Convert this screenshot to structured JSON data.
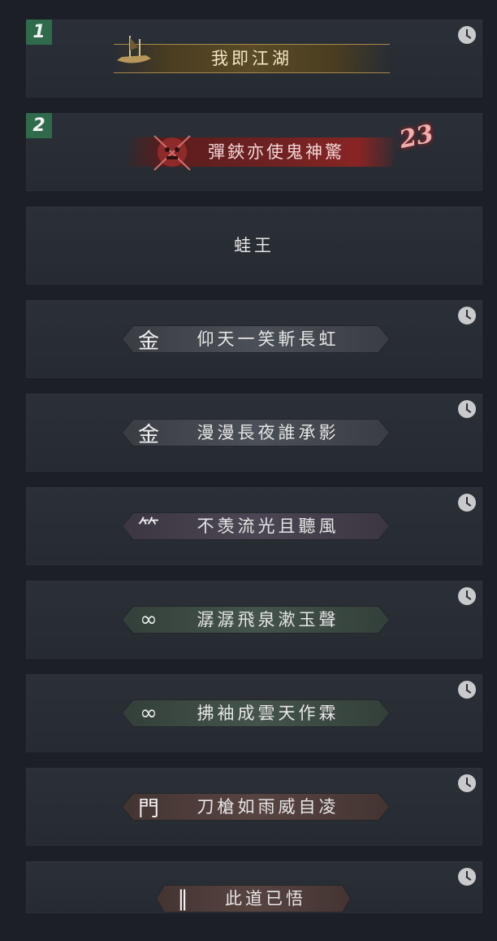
{
  "entries": [
    {
      "rank": "1",
      "title": "我即江湖"
    },
    {
      "rank": "2",
      "title": "彈鋏亦使鬼神驚",
      "count": "23"
    },
    {
      "title": "蛙王"
    },
    {
      "title": "仰天一笑斬長虹",
      "icon": "sect-emblem-icon"
    },
    {
      "title": "漫漫長夜誰承影",
      "icon": "sect-emblem-icon"
    },
    {
      "title": "不羡流光且聽風",
      "icon": "bamboo-icon"
    },
    {
      "title": "潺潺飛泉漱玉聲",
      "icon": "knot-icon"
    },
    {
      "title": "拂袖成雲天作霖",
      "icon": "knot-icon"
    },
    {
      "title": "刀槍如雨威自凌",
      "icon": "gate-icon"
    },
    {
      "title": "此道已悟",
      "icon": "blades-icon"
    }
  ],
  "colors": {
    "rank_badge": "#2f6b4a",
    "gold": "#a7894a",
    "red": "#8a2424"
  }
}
